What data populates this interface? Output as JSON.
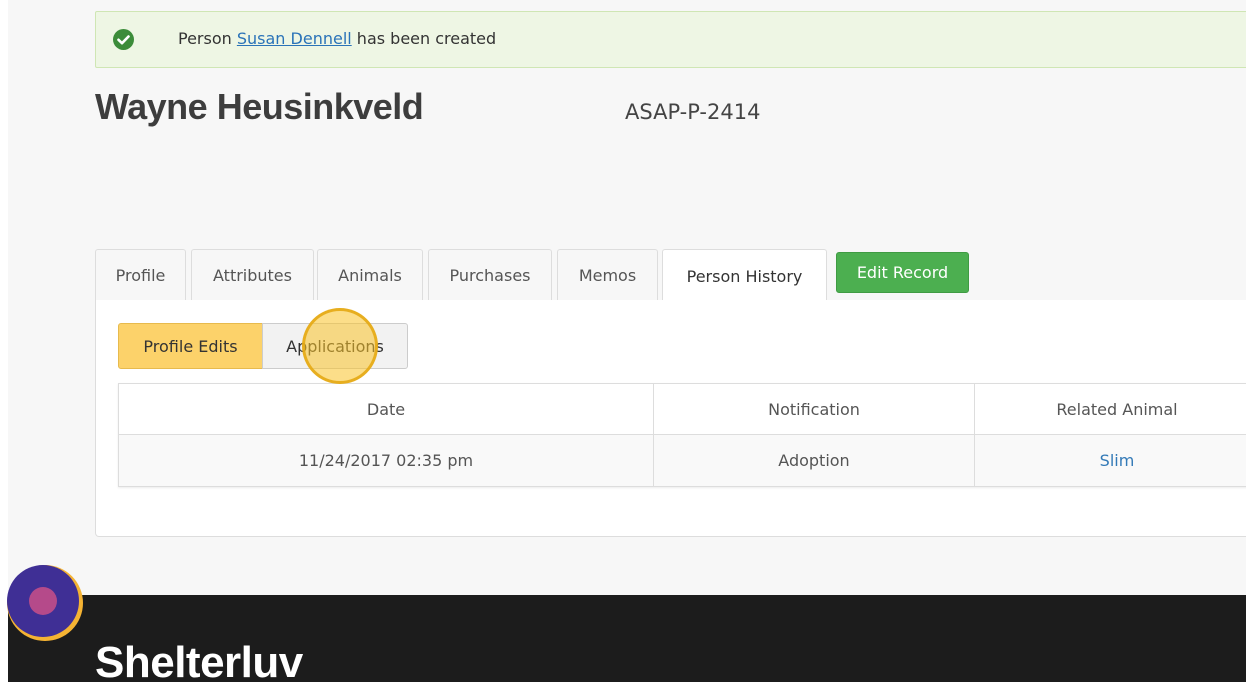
{
  "alert": {
    "prefix": "Person",
    "link": "Susan Dennell",
    "suffix": "has been created"
  },
  "person": {
    "name": "Wayne Heusinkveld",
    "id": "ASAP-P-2414"
  },
  "tabs": [
    {
      "label": "Profile"
    },
    {
      "label": "Attributes"
    },
    {
      "label": "Animals"
    },
    {
      "label": "Purchases"
    },
    {
      "label": "Memos"
    },
    {
      "label": "Person History",
      "active": true
    }
  ],
  "edit_button": "Edit Record",
  "subtabs": {
    "profile_edits": "Profile Edits",
    "applications": "Applications"
  },
  "table": {
    "headers": [
      "Date",
      "Notification",
      "Related Animal"
    ],
    "rows": [
      [
        "11/24/2017 02:35 pm",
        "Adoption",
        "Slim"
      ]
    ]
  },
  "footer": {
    "brand": "Shelterluv"
  },
  "colors": {
    "success_green": "#4caf50",
    "alert_bg": "#eef6e4",
    "active_subtab": "#fcd26a",
    "link": "#337ab7",
    "footer_bg": "#1c1c1c"
  }
}
